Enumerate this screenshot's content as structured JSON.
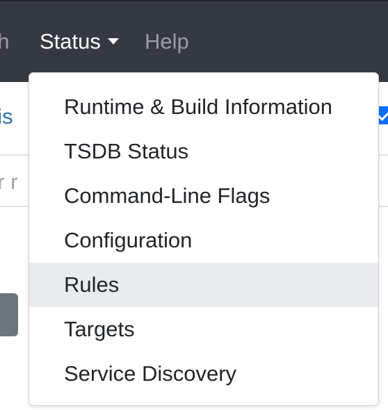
{
  "navbar": {
    "items": [
      {
        "label": "ph"
      },
      {
        "label": "Status"
      },
      {
        "label": "Help"
      }
    ]
  },
  "background": {
    "history_link": "his",
    "expression_placeholder": "or r"
  },
  "status_menu": {
    "items": [
      {
        "label": "Runtime & Build Information"
      },
      {
        "label": "TSDB Status"
      },
      {
        "label": "Command-Line Flags"
      },
      {
        "label": "Configuration"
      },
      {
        "label": "Rules",
        "highlighted": true
      },
      {
        "label": "Targets"
      },
      {
        "label": "Service Discovery"
      }
    ]
  },
  "colors": {
    "navbar_bg": "#343a40",
    "highlight_bg": "#e9ecef",
    "link": "#2a6fb4",
    "checkbox": "#0d6efd"
  }
}
